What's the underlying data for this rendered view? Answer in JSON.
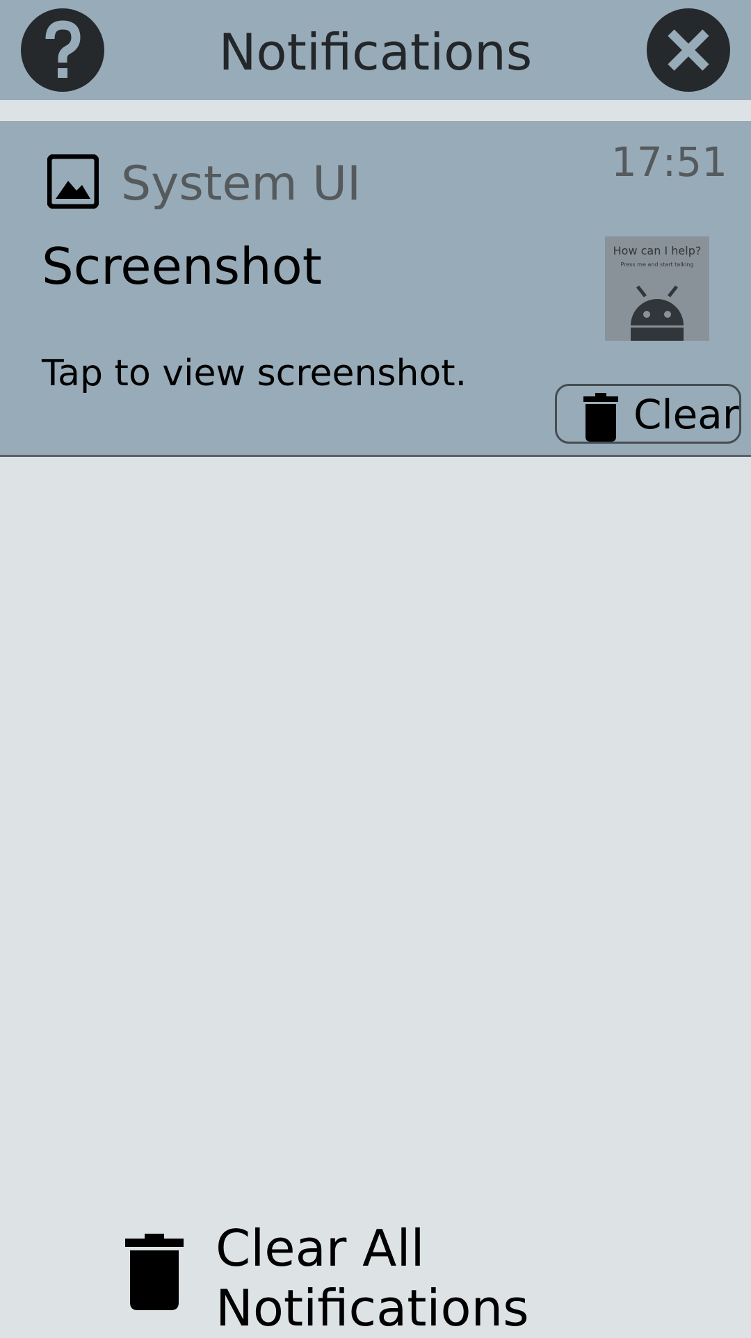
{
  "header": {
    "title": "Notifications",
    "help_icon": "question-mark-icon",
    "close_icon": "close-icon"
  },
  "notification": {
    "app_icon": "image-icon",
    "app_name": "System UI",
    "time": "17:51",
    "title": "Screenshot",
    "text": "Tap to view screenshot.",
    "thumbnail": {
      "title": "How can I help?",
      "subtitle": "Press me and start talking",
      "icon": "android-robot-icon"
    },
    "clear_icon": "trash-icon",
    "clear_label": "Clear"
  },
  "footer": {
    "clear_all_icon": "trash-icon",
    "clear_all_line1": "Clear All",
    "clear_all_line2": "Notifications"
  },
  "colors": {
    "background": "#dde3e5",
    "bar": "#98abb8",
    "dark_button": "#25292c",
    "secondary_text": "#555a5d"
  }
}
